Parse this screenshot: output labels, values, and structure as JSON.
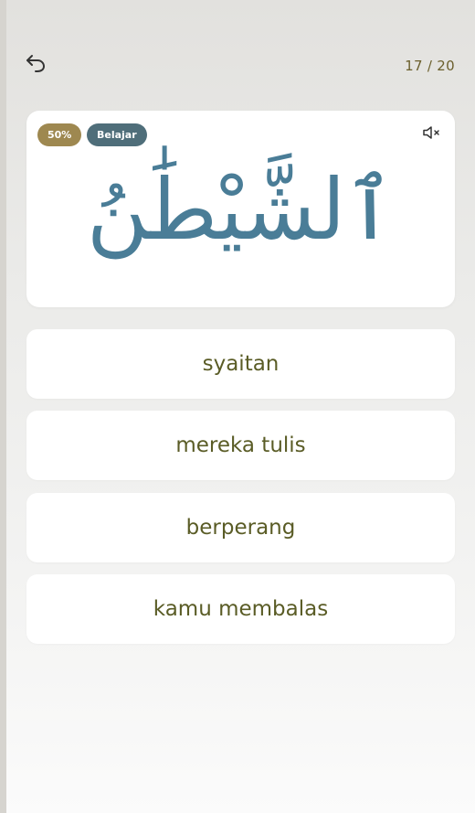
{
  "header": {
    "back_icon": "undo-arrow-icon",
    "progress": "17 / 20"
  },
  "card": {
    "mastery_badge": "50%",
    "mode_badge": "Belajar",
    "mute_icon": "speaker-muted-icon",
    "arabic_word": "ٱلشَّيْطَٰنُ"
  },
  "options": [
    {
      "label": "syaitan"
    },
    {
      "label": "mereka tulis"
    },
    {
      "label": "berperang"
    },
    {
      "label": "kamu membalas"
    }
  ],
  "colors": {
    "badge_percent": "#9e8850",
    "badge_mode": "#4f6e7a",
    "arabic_text": "#4a7d97",
    "option_text": "#5a5c26",
    "counter_text": "#6b5f2c"
  }
}
